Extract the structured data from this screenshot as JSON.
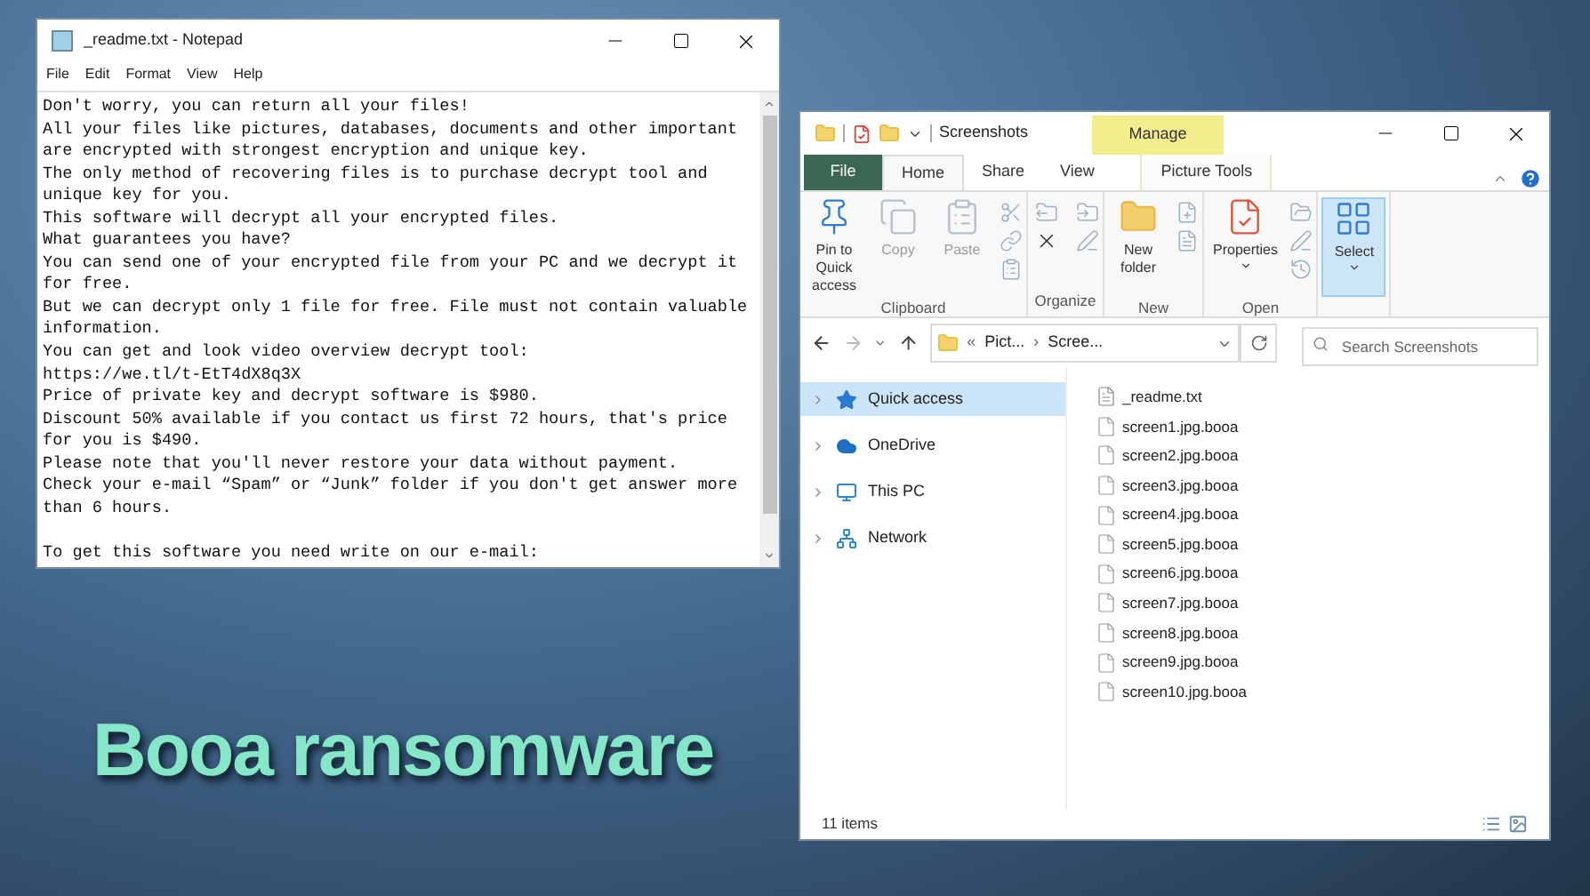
{
  "notepad": {
    "title": "_readme.txt - Notepad",
    "menu": [
      "File",
      "Edit",
      "Format",
      "View",
      "Help"
    ],
    "text_blocks": [
      [
        "Don't worry, you can return all your files!",
        "All your files like pictures, databases, documents and other important",
        "are encrypted with strongest encryption and unique key.",
        "The only method of recovering files is to purchase decrypt tool and",
        "unique key for you.",
        "This software will decrypt all your encrypted files.",
        "What guarantees you have?",
        "You can send one of your encrypted file from your PC and we decrypt it",
        "for free.",
        "But we can decrypt only 1 file for free. File must not contain valuable",
        "information.",
        "You can get and look video overview decrypt tool:",
        "https://we.tl/t-EtT4dX8q3X",
        "Price of private key and decrypt software is $980.",
        "Discount 50% available if you contact us first 72 hours, that's price",
        "for you is $490.",
        "Please note that you'll never restore your data without payment.",
        "Check your e-mail “Spam” or “Junk” folder if you don't get answer more",
        "than 6 hours."
      ],
      [
        "To get this software you need write on our e-mail:"
      ]
    ]
  },
  "explorer": {
    "title": "Screenshots",
    "context_tab": "Manage",
    "tabs": [
      {
        "label": "File",
        "kind": "file",
        "selected": false
      },
      {
        "label": "Home",
        "kind": "normal",
        "selected": true
      },
      {
        "label": "Share",
        "kind": "normal",
        "selected": false
      },
      {
        "label": "View",
        "kind": "normal",
        "selected": false
      },
      {
        "label": "Picture Tools",
        "kind": "context",
        "selected": false
      }
    ],
    "ribbon_groups": [
      {
        "label": "Clipboard",
        "buttons": [
          {
            "label": "Pin to Quick access",
            "disabled": false
          },
          {
            "label": "Copy",
            "disabled": true
          },
          {
            "label": "Paste",
            "disabled": true
          }
        ]
      },
      {
        "label": "Organize"
      },
      {
        "label": "New",
        "buttons": [
          {
            "label": "New folder",
            "disabled": false
          }
        ]
      },
      {
        "label": "Open",
        "buttons": [
          {
            "label": "Properties",
            "disabled": false,
            "dropdown": true
          }
        ]
      },
      {
        "buttons": [
          {
            "label": "Select",
            "disabled": false,
            "dropdown": true,
            "selected": true
          }
        ]
      }
    ],
    "address": {
      "overflow": "«",
      "crumbs": [
        "Pict...",
        "Scree..."
      ],
      "separator": "›"
    },
    "search": {
      "placeholder": "Search Screenshots"
    },
    "nav": [
      {
        "label": "Quick access",
        "selected": true
      },
      {
        "label": "OneDrive",
        "selected": false
      },
      {
        "label": "This PC",
        "selected": false
      },
      {
        "label": "Network",
        "selected": false
      }
    ],
    "files": [
      {
        "name": "_readme.txt",
        "kind": "text"
      },
      {
        "name": "screen1.jpg.booa",
        "kind": "blank"
      },
      {
        "name": "screen2.jpg.booa",
        "kind": "blank"
      },
      {
        "name": "screen3.jpg.booa",
        "kind": "blank"
      },
      {
        "name": "screen4.jpg.booa",
        "kind": "blank"
      },
      {
        "name": "screen5.jpg.booa",
        "kind": "blank"
      },
      {
        "name": "screen6.jpg.booa",
        "kind": "blank"
      },
      {
        "name": "screen7.jpg.booa",
        "kind": "blank"
      },
      {
        "name": "screen8.jpg.booa",
        "kind": "blank"
      },
      {
        "name": "screen9.jpg.booa",
        "kind": "blank"
      },
      {
        "name": "screen10.jpg.booa",
        "kind": "blank"
      }
    ],
    "status_bar": "11 items"
  },
  "headline": "Booa ransomware"
}
